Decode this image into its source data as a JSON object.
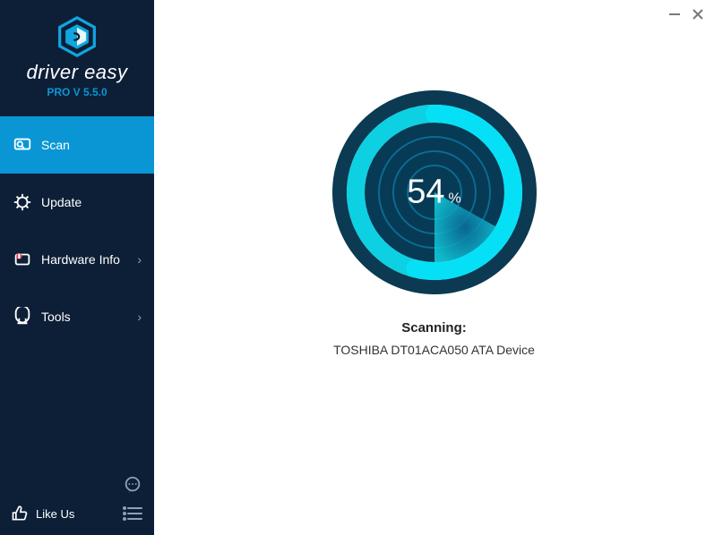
{
  "app": {
    "name": "driver easy",
    "version": "PRO V 5.5.0"
  },
  "sidebar": {
    "items": [
      {
        "label": "Scan",
        "icon": "scan-icon",
        "active": true,
        "hasChevron": false
      },
      {
        "label": "Update",
        "icon": "update-icon",
        "active": false,
        "hasChevron": false
      },
      {
        "label": "Hardware Info",
        "icon": "hardware-info-icon",
        "active": false,
        "hasChevron": true
      },
      {
        "label": "Tools",
        "icon": "tools-icon",
        "active": false,
        "hasChevron": true
      }
    ],
    "likeUs": "Like Us"
  },
  "scan": {
    "progress": 54,
    "progressSymbol": "%",
    "statusLabel": "Scanning:",
    "currentDevice": "TOSHIBA DT01ACA050 ATA Device"
  },
  "colors": {
    "sidebarBg": "#0d1f37",
    "accent": "#0a96d4",
    "ringDark": "#083b56",
    "ringCyan": "#0cc8d9",
    "ringInner": "#0a94c2"
  }
}
